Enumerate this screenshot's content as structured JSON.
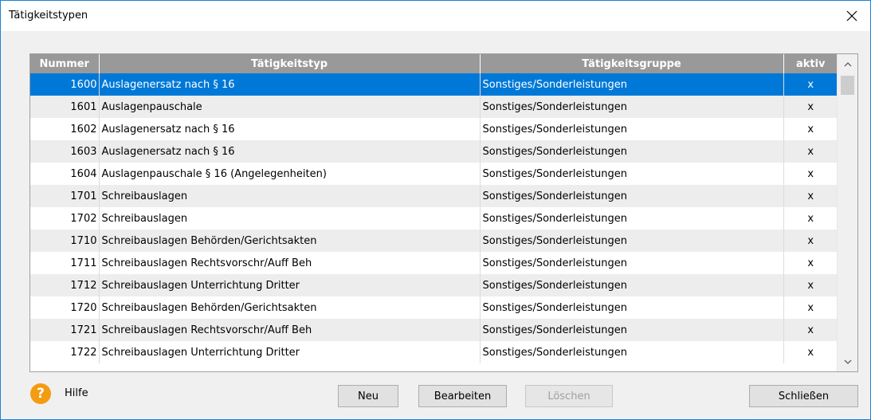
{
  "window": {
    "title": "Tätigkeitstypen"
  },
  "table": {
    "headers": [
      "Nummer",
      "Tätigkeitstyp",
      "Tätigkeitsgruppe",
      "aktiv"
    ],
    "rows": [
      [
        "1600",
        "Auslagenersatz nach § 16",
        "Sonstiges/Sonderleistungen",
        "x"
      ],
      [
        "1601",
        "Auslagenpauschale",
        "Sonstiges/Sonderleistungen",
        "x"
      ],
      [
        "1602",
        "Auslagenersatz nach § 16",
        "Sonstiges/Sonderleistungen",
        "x"
      ],
      [
        "1603",
        "Auslagenersatz nach § 16",
        "Sonstiges/Sonderleistungen",
        "x"
      ],
      [
        "1604",
        "Auslagenpauschale § 16 (Angelegenheiten)",
        "Sonstiges/Sonderleistungen",
        "x"
      ],
      [
        "1701",
        "Schreibauslagen",
        "Sonstiges/Sonderleistungen",
        "x"
      ],
      [
        "1702",
        "Schreibauslagen",
        "Sonstiges/Sonderleistungen",
        "x"
      ],
      [
        "1710",
        "Schreibauslagen Behörden/Gerichtsakten",
        "Sonstiges/Sonderleistungen",
        "x"
      ],
      [
        "1711",
        "Schreibauslagen Rechtsvorschr/Auff Beh",
        "Sonstiges/Sonderleistungen",
        "x"
      ],
      [
        "1712",
        "Schreibauslagen Unterrichtung Dritter",
        "Sonstiges/Sonderleistungen",
        "x"
      ],
      [
        "1720",
        "Schreibauslagen Behörden/Gerichtsakten",
        "Sonstiges/Sonderleistungen",
        "x"
      ],
      [
        "1721",
        "Schreibauslagen Rechtsvorschr/Auff Beh",
        "Sonstiges/Sonderleistungen",
        "x"
      ],
      [
        "1722",
        "Schreibauslagen Unterrichtung Dritter",
        "Sonstiges/Sonderleistungen",
        "x"
      ]
    ],
    "selected_row": 0
  },
  "footer": {
    "help_icon": "question-icon",
    "help_glyph": "?",
    "help_label": "Hilfe",
    "new_label": "Neu",
    "edit_label": "Bearbeiten",
    "delete_label": "Löschen",
    "close_label": "Schließen"
  },
  "colors": {
    "header_bg": "#999999",
    "selection": "#0078d7",
    "help_icon": "#f39c12",
    "alt_row": "#ededed"
  }
}
